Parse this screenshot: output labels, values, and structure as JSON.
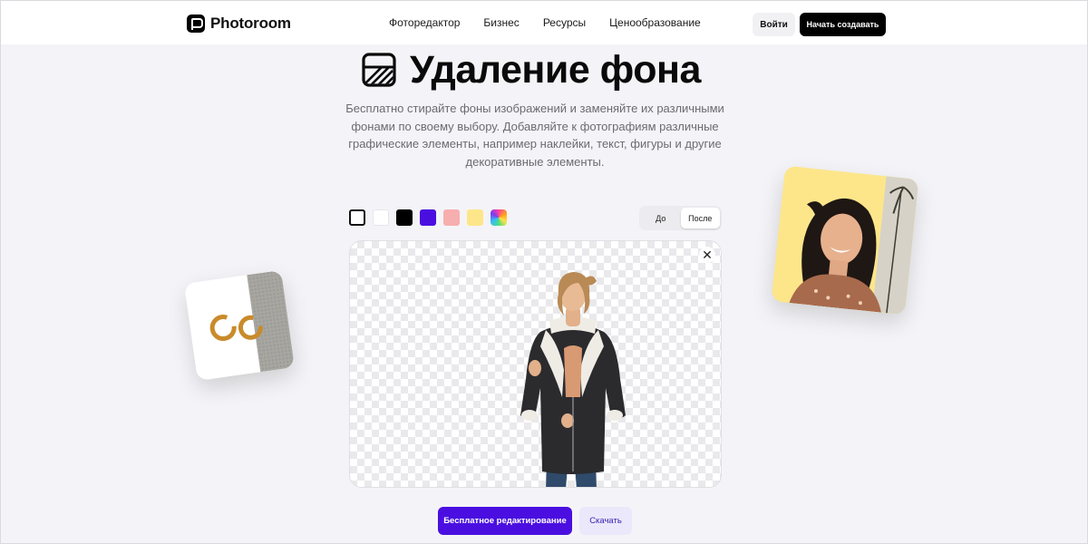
{
  "brand": {
    "name": "Photoroom"
  },
  "nav": {
    "items": [
      "Фоторедактор",
      "Бизнес",
      "Ресурсы",
      "Ценообразование"
    ]
  },
  "header": {
    "login_label": "Войти",
    "start_label": "Начать создавать"
  },
  "hero": {
    "title": "Удаление фона",
    "subtitle": "Бесплатно стирайте фоны изображений и заменяйте их различными фонами по своему выбору. Добавляйте к фотографиям различные графические элементы, например наклейки, текст, фигуры и другие декоративные элементы."
  },
  "swatches": [
    {
      "name": "transparent",
      "color": "transparent"
    },
    {
      "name": "white",
      "color": "#ffffff"
    },
    {
      "name": "black",
      "color": "#000000"
    },
    {
      "name": "purple",
      "color": "#4a0fe0"
    },
    {
      "name": "pink",
      "color": "#f7aeae"
    },
    {
      "name": "yellow",
      "color": "#fde68a"
    },
    {
      "name": "gradient",
      "color": "gradient"
    }
  ],
  "toggle": {
    "before_label": "До",
    "after_label": "После",
    "active": "after"
  },
  "actions": {
    "edit_label": "Бесплатное редактирование",
    "download_label": "Скачать"
  },
  "colors": {
    "accent": "#4a0fe0",
    "accent_light": "#ebe8fb",
    "page_bg": "#f4f4f8"
  }
}
